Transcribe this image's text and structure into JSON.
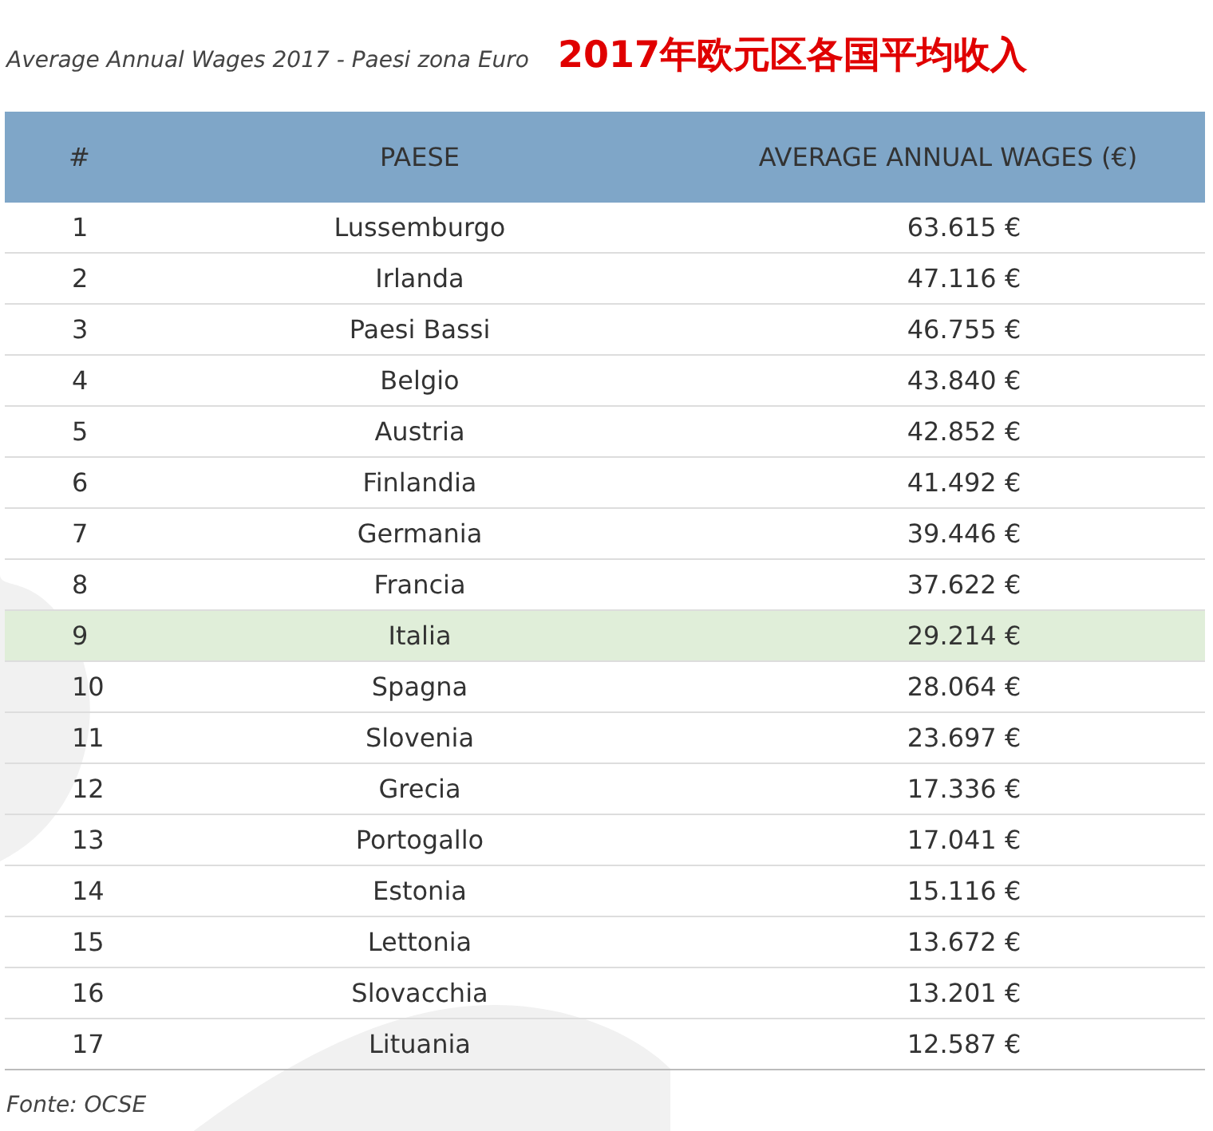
{
  "caption": "Average Annual Wages 2017 - Paesi zona Euro",
  "headline": "2017年欧元区各国平均收入",
  "table": {
    "columns": [
      "#",
      "PAESE",
      "AVERAGE ANNUAL WAGES (€)"
    ],
    "rows": [
      {
        "rank": "1",
        "country": "Lussemburgo",
        "wage": "63.615 €",
        "highlighted": false
      },
      {
        "rank": "2",
        "country": "Irlanda",
        "wage": "47.116 €",
        "highlighted": false
      },
      {
        "rank": "3",
        "country": "Paesi Bassi",
        "wage": "46.755 €",
        "highlighted": false
      },
      {
        "rank": "4",
        "country": "Belgio",
        "wage": "43.840 €",
        "highlighted": false
      },
      {
        "rank": "5",
        "country": "Austria",
        "wage": "42.852 €",
        "highlighted": false
      },
      {
        "rank": "6",
        "country": "Finlandia",
        "wage": "41.492 €",
        "highlighted": false
      },
      {
        "rank": "7",
        "country": "Germania",
        "wage": "39.446 €",
        "highlighted": false
      },
      {
        "rank": "8",
        "country": "Francia",
        "wage": "37.622 €",
        "highlighted": false
      },
      {
        "rank": "9",
        "country": "Italia",
        "wage": "29.214 €",
        "highlighted": true
      },
      {
        "rank": "10",
        "country": "Spagna",
        "wage": "28.064 €",
        "highlighted": false
      },
      {
        "rank": "11",
        "country": "Slovenia",
        "wage": "23.697 €",
        "highlighted": false
      },
      {
        "rank": "12",
        "country": "Grecia",
        "wage": "17.336 €",
        "highlighted": false
      },
      {
        "rank": "13",
        "country": "Portogallo",
        "wage": "17.041 €",
        "highlighted": false
      },
      {
        "rank": "14",
        "country": "Estonia",
        "wage": "15.116 €",
        "highlighted": false
      },
      {
        "rank": "15",
        "country": "Lettonia",
        "wage": "13.672 €",
        "highlighted": false
      },
      {
        "rank": "16",
        "country": "Slovacchia",
        "wage": "13.201 €",
        "highlighted": false
      },
      {
        "rank": "17",
        "country": "Lituania",
        "wage": "12.587 €",
        "highlighted": false
      }
    ]
  },
  "source": "Fonte: OCSE"
}
